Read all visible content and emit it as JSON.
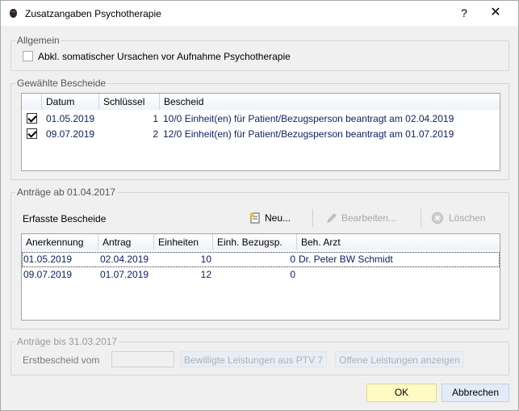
{
  "window": {
    "title": "Zusatzangaben Psychotherapie",
    "help_label": "?",
    "close_label": "✕"
  },
  "allgemein": {
    "legend": "Allgemein",
    "checkbox_label": "Abkl. somatischer Ursachen vor Aufnahme Psychotherapie",
    "checked": false
  },
  "bescheide": {
    "legend": "Gewählte Bescheide",
    "columns": [
      "",
      "Datum",
      "Schlüssel",
      "Bescheid"
    ],
    "rows": [
      {
        "checked": true,
        "datum": "01.05.2019",
        "schluessel": "1",
        "bescheid": "10/0 Einheit(en) für Patient/Bezugsperson beantragt am 02.04.2019"
      },
      {
        "checked": true,
        "datum": "09.07.2019",
        "schluessel": "2",
        "bescheid": "12/0 Einheit(en) für Patient/Bezugsperson beantragt am 01.07.2019"
      }
    ]
  },
  "antraege_ab": {
    "legend": "Anträge ab 01.04.2017",
    "subtitle": "Erfasste Bescheide",
    "toolbar": {
      "new_label": "Neu...",
      "edit_label": "Bearbeiten...",
      "delete_label": "Löschen"
    },
    "columns": [
      "Anerkennung",
      "Antrag",
      "Einheiten",
      "Einh. Bezugsp.",
      "Beh. Arzt"
    ],
    "rows": [
      {
        "anerkennung": "01.05.2019",
        "antrag": "02.04.2019",
        "einheiten": "10",
        "bezugsp": "0",
        "arzt": "Dr. Peter BW Schmidt"
      },
      {
        "anerkennung": "09.07.2019",
        "antrag": "01.07.2019",
        "einheiten": "12",
        "bezugsp": "0",
        "arzt": ""
      }
    ]
  },
  "antraege_bis": {
    "legend": "Anträge bis 31.03.2017",
    "erstbescheid_label": "Erstbescheid vom",
    "erstbescheid_value": "",
    "bewilligte_label": "Bewilligte Leistungen aus PTV 7",
    "offene_label": "Offene Leistungen anzeigen"
  },
  "footer": {
    "ok_label": "OK",
    "cancel_label": "Abbrechen"
  }
}
